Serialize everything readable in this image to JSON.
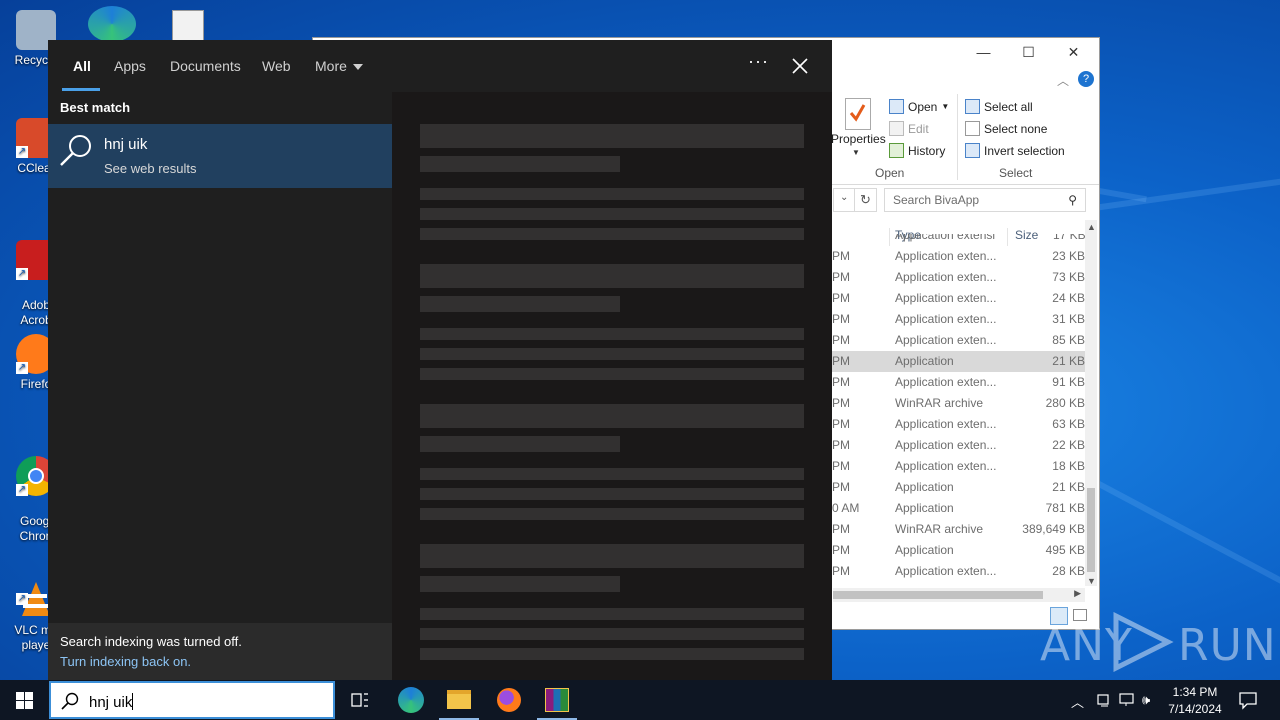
{
  "desktop": {
    "icons": [
      {
        "label": "Recycle",
        "color": "#9fb3c8"
      },
      {
        "label": "CClear",
        "color": "#d84a2a"
      },
      {
        "label": "Adob\nAcrob",
        "color": "#c81e1e"
      },
      {
        "label": "Firefo",
        "color": "#ff7a1a"
      },
      {
        "label": "Googl\nChron",
        "color": "#2a9d3f"
      },
      {
        "label": "VLC me\nplaye",
        "color": "#f08a12"
      }
    ]
  },
  "explorer": {
    "window_buttons": {
      "minimize": "—",
      "maximize": "☐",
      "close": "✕"
    },
    "ribbon": {
      "properties": "Properties",
      "open": "Open",
      "edit": "Edit",
      "history": "History",
      "open_group": "Open",
      "select_all": "Select all",
      "select_none": "Select none",
      "invert_selection": "Invert selection",
      "select_group": "Select"
    },
    "search_placeholder": "Search BivaApp",
    "columns": {
      "type": "Type",
      "size": "Size"
    },
    "rows": [
      {
        "date": "PM",
        "type": "Application exten...",
        "size": "23 KB",
        "selected": false
      },
      {
        "date": "PM",
        "type": "Application exten...",
        "size": "73 KB",
        "selected": false
      },
      {
        "date": "PM",
        "type": "Application exten...",
        "size": "24 KB",
        "selected": false
      },
      {
        "date": "PM",
        "type": "Application exten...",
        "size": "31 KB",
        "selected": false
      },
      {
        "date": "PM",
        "type": "Application exten...",
        "size": "85 KB",
        "selected": false
      },
      {
        "date": "PM",
        "type": "Application",
        "size": "21 KB",
        "selected": true
      },
      {
        "date": "PM",
        "type": "Application exten...",
        "size": "91 KB",
        "selected": false
      },
      {
        "date": "PM",
        "type": "WinRAR archive",
        "size": "280 KB",
        "selected": false
      },
      {
        "date": "PM",
        "type": "Application exten...",
        "size": "63 KB",
        "selected": false
      },
      {
        "date": "PM",
        "type": "Application exten...",
        "size": "22 KB",
        "selected": false
      },
      {
        "date": "PM",
        "type": "Application exten...",
        "size": "18 KB",
        "selected": false
      },
      {
        "date": "PM",
        "type": "Application",
        "size": "21 KB",
        "selected": false
      },
      {
        "date": "0 AM",
        "type": "Application",
        "size": "781 KB",
        "selected": false
      },
      {
        "date": "PM",
        "type": "WinRAR archive",
        "size": "389,649 KB",
        "selected": false
      },
      {
        "date": "PM",
        "type": "Application",
        "size": "495 KB",
        "selected": false
      },
      {
        "date": "PM",
        "type": "Application exten...",
        "size": "28 KB",
        "selected": false
      }
    ]
  },
  "search_panel": {
    "tabs": [
      {
        "label": "All",
        "active": true
      },
      {
        "label": "Apps",
        "active": false
      },
      {
        "label": "Documents",
        "active": false
      },
      {
        "label": "Web",
        "active": false
      },
      {
        "label": "More",
        "active": false
      }
    ],
    "more_options": "···",
    "best_match_label": "Best match",
    "best_match": {
      "title": "hnj uik",
      "subtitle": "See web results"
    },
    "indexing_message": "Search indexing was turned off.",
    "indexing_link": "Turn indexing back on."
  },
  "taskbar": {
    "search_query": "hnj uik",
    "apps": [
      "task-view",
      "edge",
      "file-explorer",
      "firefox",
      "winrar"
    ],
    "clock_time": "1:34 PM",
    "clock_date": "7/14/2024"
  },
  "watermark": {
    "text": "ANY",
    "text2": "RUN"
  },
  "colors": {
    "accent": "#4aa0e8",
    "best_match_bg": "#21405f",
    "taskbar": "#0e1623"
  }
}
